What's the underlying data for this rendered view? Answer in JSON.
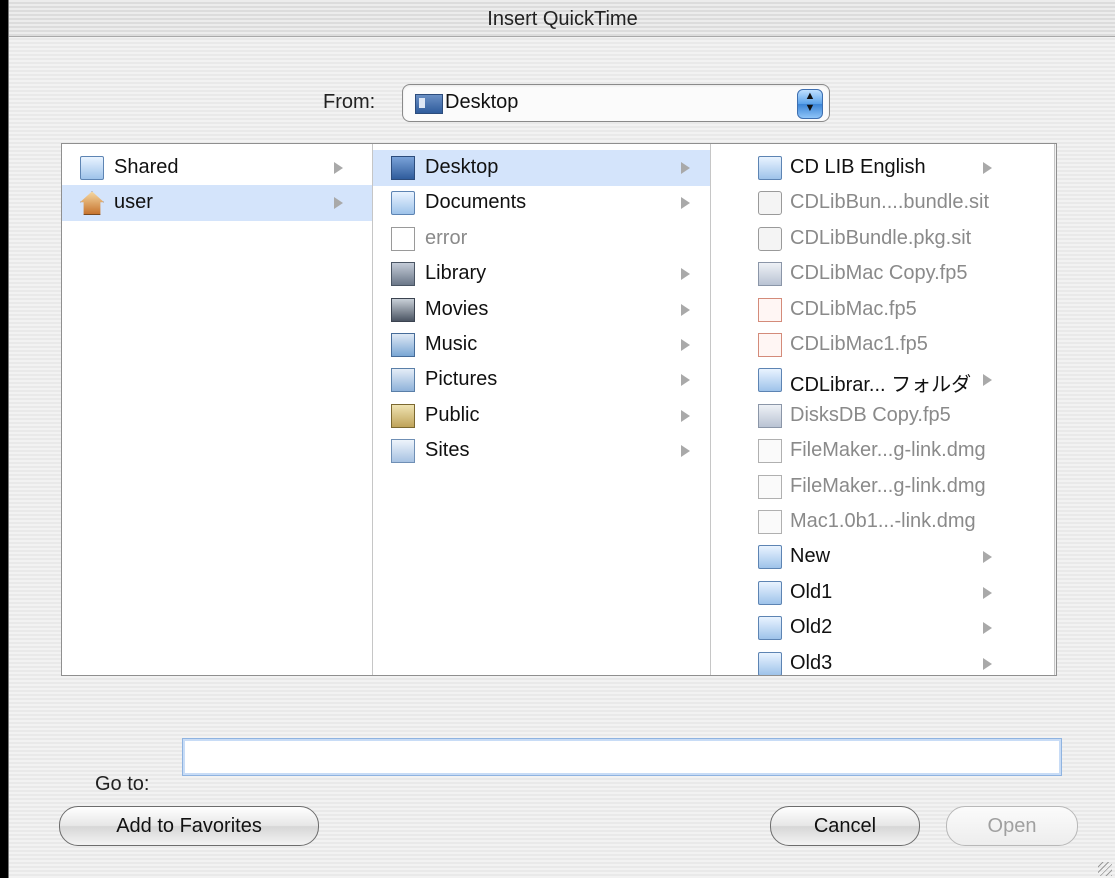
{
  "window": {
    "title": "Insert QuickTime"
  },
  "from": {
    "label": "From:",
    "selected": "Desktop"
  },
  "columns": {
    "col1": [
      {
        "label": "Shared",
        "icon": "folder-icon",
        "arrow": true,
        "selected": false,
        "dim": false
      },
      {
        "label": "user",
        "icon": "home-icon",
        "arrow": true,
        "selected": true,
        "dim": false
      }
    ],
    "col2": [
      {
        "label": "Desktop",
        "icon": "desktop-icon",
        "arrow": true,
        "selected": true,
        "dim": false
      },
      {
        "label": "Documents",
        "icon": "documents-folder-icon",
        "arrow": true,
        "selected": false,
        "dim": false
      },
      {
        "label": "error",
        "icon": "document-icon",
        "arrow": false,
        "selected": false,
        "dim": true
      },
      {
        "label": "Library",
        "icon": "library-folder-icon",
        "arrow": true,
        "selected": false,
        "dim": false
      },
      {
        "label": "Movies",
        "icon": "movies-folder-icon",
        "arrow": true,
        "selected": false,
        "dim": false
      },
      {
        "label": "Music",
        "icon": "music-folder-icon",
        "arrow": true,
        "selected": false,
        "dim": false
      },
      {
        "label": "Pictures",
        "icon": "pictures-folder-icon",
        "arrow": true,
        "selected": false,
        "dim": false
      },
      {
        "label": "Public",
        "icon": "public-folder-icon",
        "arrow": true,
        "selected": false,
        "dim": false
      },
      {
        "label": "Sites",
        "icon": "sites-folder-icon",
        "arrow": true,
        "selected": false,
        "dim": false
      }
    ],
    "col3": [
      {
        "label": "CD LIB English",
        "icon": "folder-icon",
        "arrow": true,
        "dim": false
      },
      {
        "label": "CDLibBun....bundle.sit",
        "icon": "stuffit-archive-icon",
        "arrow": false,
        "dim": true
      },
      {
        "label": "CDLibBundle.pkg.sit",
        "icon": "stuffit-archive-icon",
        "arrow": false,
        "dim": true
      },
      {
        "label": "CDLibMac Copy.fp5",
        "icon": "filemaker-document-icon",
        "arrow": false,
        "dim": true
      },
      {
        "label": "CDLibMac.fp5",
        "icon": "pdf-document-icon",
        "arrow": false,
        "dim": true
      },
      {
        "label": "CDLibMac1.fp5",
        "icon": "pdf-document-icon",
        "arrow": false,
        "dim": true
      },
      {
        "label": "CDLibrar... フォルダ",
        "icon": "folder-icon",
        "arrow": true,
        "dim": false
      },
      {
        "label": "DisksDB Copy.fp5",
        "icon": "filemaker-document-icon",
        "arrow": false,
        "dim": true
      },
      {
        "label": "FileMaker...g-link.dmg",
        "icon": "disk-image-icon",
        "arrow": false,
        "dim": true
      },
      {
        "label": "FileMaker...g-link.dmg",
        "icon": "disk-image-icon",
        "arrow": false,
        "dim": true
      },
      {
        "label": "Mac1.0b1...-link.dmg",
        "icon": "disk-image-icon",
        "arrow": false,
        "dim": true
      },
      {
        "label": "New",
        "icon": "folder-icon",
        "arrow": true,
        "dim": false
      },
      {
        "label": "Old1",
        "icon": "folder-icon",
        "arrow": true,
        "dim": false
      },
      {
        "label": "Old2",
        "icon": "folder-icon",
        "arrow": true,
        "dim": false
      },
      {
        "label": "Old3",
        "icon": "folder-icon",
        "arrow": true,
        "dim": false
      }
    ]
  },
  "goto": {
    "label": "Go to:",
    "value": "",
    "placeholder": ""
  },
  "buttons": {
    "add_favorites": "Add to Favorites",
    "cancel": "Cancel",
    "open": "Open"
  }
}
